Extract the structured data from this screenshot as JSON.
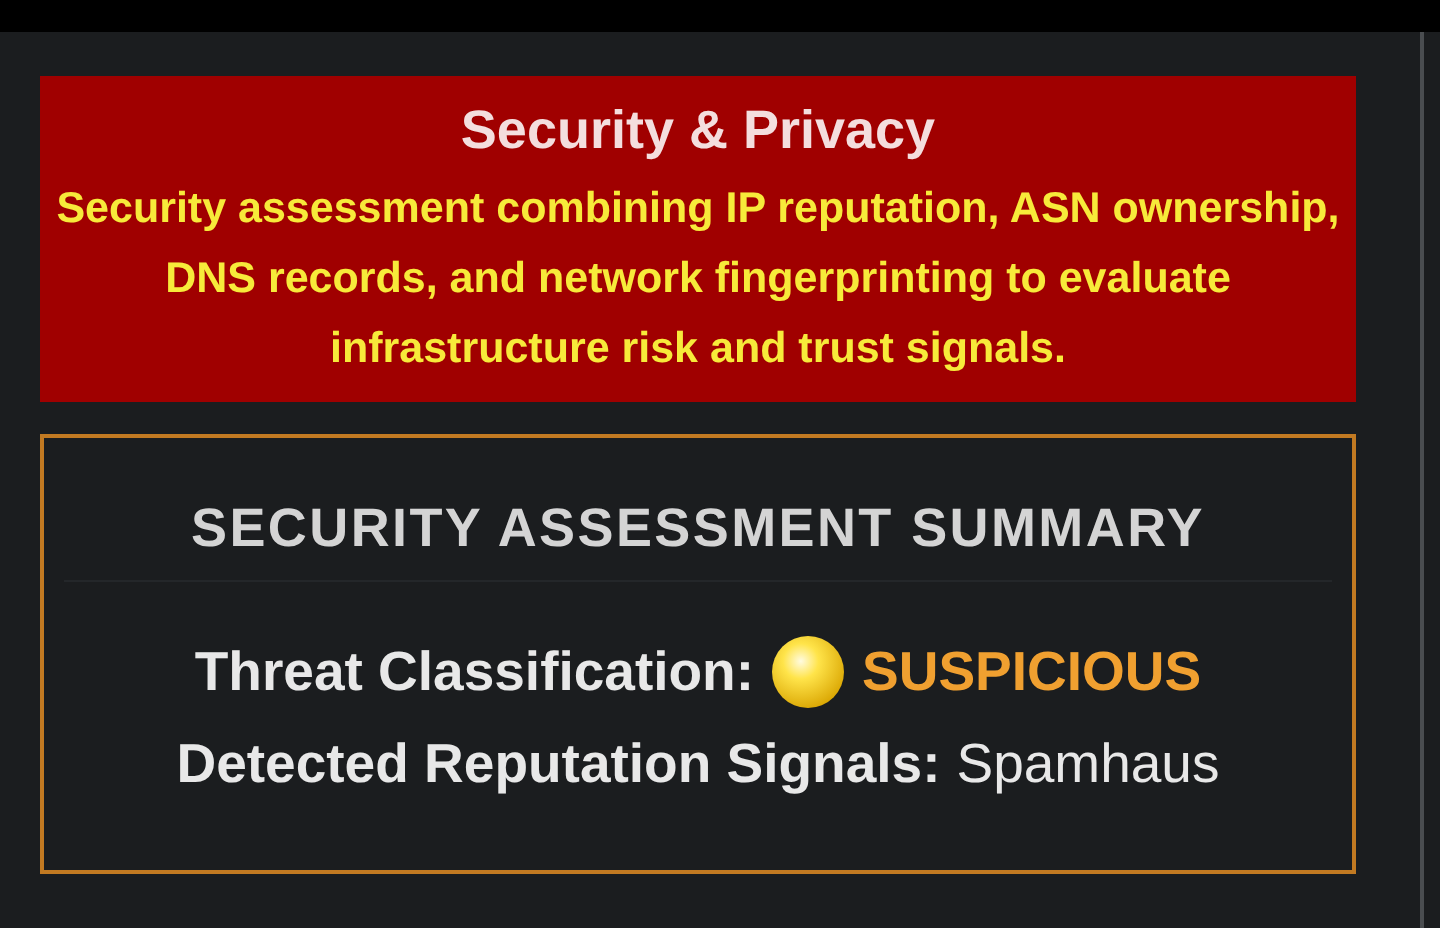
{
  "banner": {
    "title": "Security & Privacy",
    "description": "Security assessment combining IP reputation, ASN ownership, DNS records, and network fingerprinting to evaluate infrastructure risk and trust signals."
  },
  "summary": {
    "heading": "SECURITY ASSESSMENT SUMMARY",
    "rows": [
      {
        "kind": "status",
        "label": "Threat Classification:",
        "value": "SUSPICIOUS",
        "color": "#f0a030"
      },
      {
        "kind": "plain",
        "label": "Detected Reputation Signals:",
        "value": "Spamhaus"
      }
    ]
  }
}
